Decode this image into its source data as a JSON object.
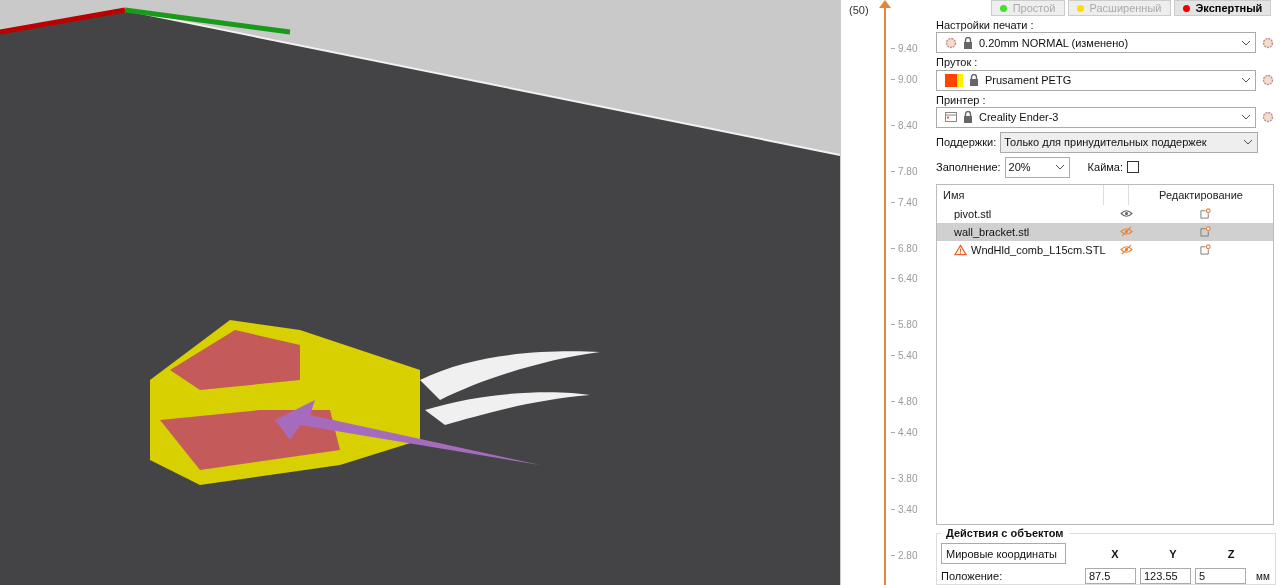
{
  "slider": {
    "top_label": "(50)",
    "ticks": [
      "9.40",
      "9.00",
      "8.40",
      "7.80",
      "7.40",
      "6.80",
      "6.40",
      "5.80",
      "5.40",
      "4.80",
      "4.40",
      "3.80",
      "3.40",
      "2.80"
    ]
  },
  "modes": [
    {
      "label": "Простой",
      "color": "#44dd33",
      "selected": false
    },
    {
      "label": "Расширенный",
      "color": "#ffdd00",
      "selected": false
    },
    {
      "label": "Экспертный",
      "color": "#ee0000",
      "selected": true
    }
  ],
  "print_settings": {
    "label": "Настройки печати :",
    "value": "0.20mm NORMAL (изменено)"
  },
  "filament": {
    "label": "Пруток :",
    "value": "Prusament PETG",
    "swatches": [
      {
        "color": "#ff4400"
      },
      {
        "color": "#ffee00"
      }
    ]
  },
  "printer": {
    "label": "Принтер :",
    "value": "Creality Ender-3"
  },
  "supports": {
    "label": "Поддержки:",
    "value": "Только для принудительных поддержек"
  },
  "infill": {
    "label": "Заполнение:",
    "value": "20%"
  },
  "brim": {
    "label": "Кайма:",
    "checked": false
  },
  "objects": {
    "columns": [
      "Имя",
      "Редактирование"
    ],
    "rows": [
      {
        "name": "pivot.stl",
        "visible": true,
        "warning": false,
        "selected": false
      },
      {
        "name": "wall_bracket.stl",
        "visible": false,
        "warning": false,
        "selected": true
      },
      {
        "name": "WndHld_comb_L15cm.STL",
        "visible": false,
        "warning": true,
        "selected": false
      }
    ]
  },
  "object_actions": {
    "title": "Действия с объектом",
    "coord_system": "Мировые координаты",
    "axes": [
      "X",
      "Y",
      "Z"
    ],
    "position": {
      "label": "Положение:",
      "values": [
        "87.5",
        "123.55",
        "5"
      ],
      "unit": "мм"
    }
  }
}
